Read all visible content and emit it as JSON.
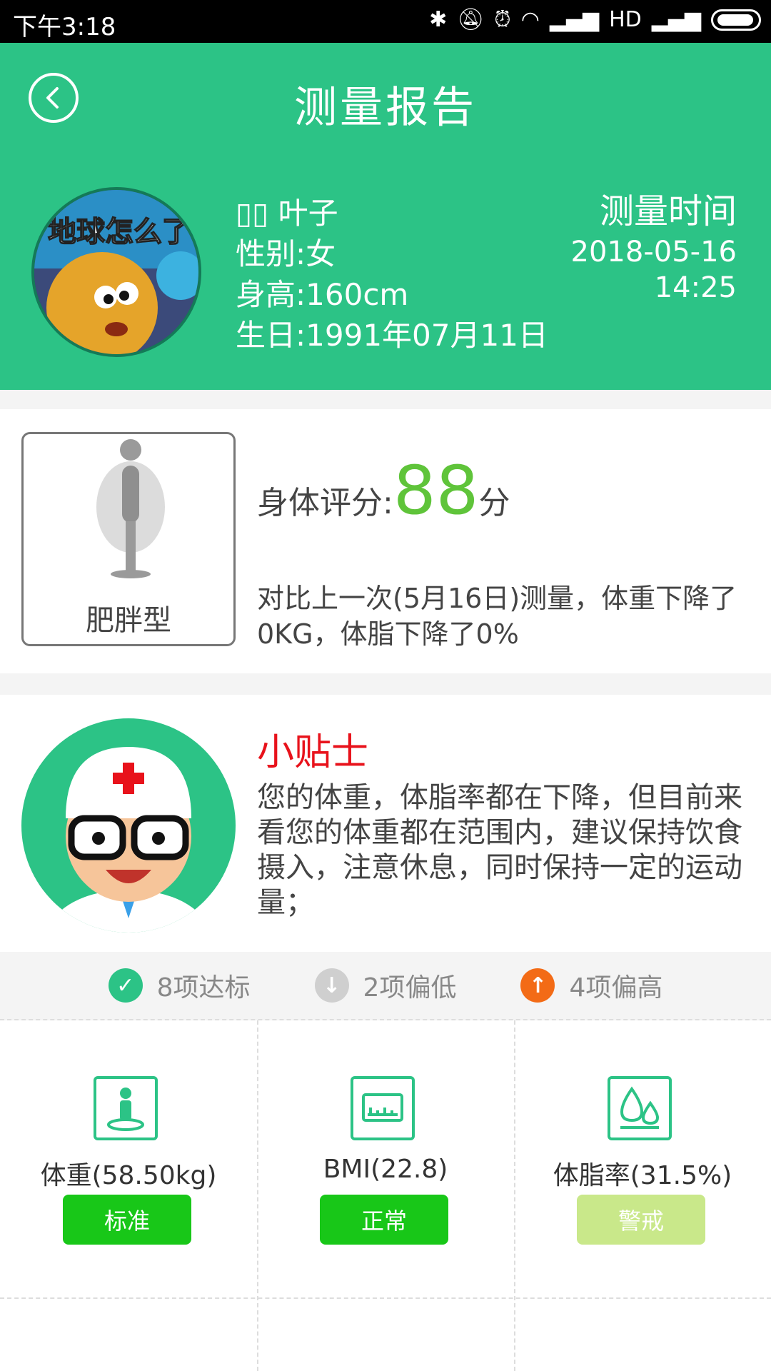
{
  "status_bar": {
    "time": "下午3:18",
    "network": "HD"
  },
  "header": {
    "title": "测量报告",
    "name_prefix": "▯▯",
    "name": "叶子",
    "gender": "性别:女",
    "height": "身高:160cm",
    "birthday": "生日:1991年07月11日",
    "avatar_text": "地球怎么了",
    "measure_time_label": "测量时间",
    "measure_date": "2018-05-16",
    "measure_clock": "14:25"
  },
  "score_card": {
    "body_type": "肥胖型",
    "score_label": "身体评分:",
    "score": "88",
    "score_unit": "分",
    "compare_text": "对比上一次(5月16日)测量，体重下降了0KG，体脂下降了0%"
  },
  "tips": {
    "title": "小贴士",
    "text": "您的体重，体脂率都在下降，但目前来看您的体重都在范围内，建议保持饮食摄入，注意休息，同时保持一定的运动量；"
  },
  "summary": {
    "normal": "8项达标",
    "low": "2项偏低",
    "high": "4项偏高"
  },
  "metrics": [
    {
      "label": "体重(58.50kg)",
      "status": "标准",
      "status_color": "#18c718",
      "icon": "person-scale-icon"
    },
    {
      "label": "BMI(22.8)",
      "status": "正常",
      "status_color": "#18c718",
      "icon": "bmi-scale-icon"
    },
    {
      "label": "体脂率(31.5%)",
      "status": "警戒",
      "status_color": "#c9e88a",
      "icon": "fat-drops-icon"
    }
  ],
  "colors": {
    "brand": "#2cc386",
    "score": "#5fc43a",
    "tips_title": "#e8121b",
    "low": "#cfcfcf",
    "high": "#f36b16",
    "ok": "#2cc386"
  }
}
